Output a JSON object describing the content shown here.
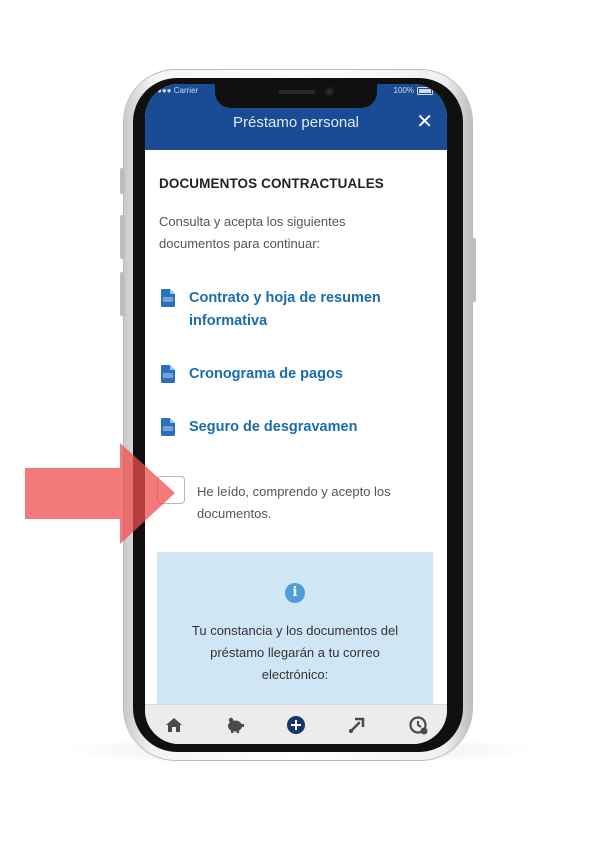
{
  "status_bar": {
    "carrier": "Carrier",
    "battery": "100%"
  },
  "header": {
    "title": "Préstamo personal",
    "close_symbol": "✕"
  },
  "section_title": "DOCUMENTOS CONTRACTUALES",
  "intro_lines": [
    "Consulta y acepta los siguientes",
    "documentos  para continuar:"
  ],
  "documents": [
    {
      "label_lines": [
        "Contrato y hoja de resumen",
        "informativa"
      ],
      "icon": "pdf-file-icon"
    },
    {
      "label_lines": [
        "Cronograma de pagos"
      ],
      "icon": "pdf-file-icon"
    },
    {
      "label_lines": [
        "Seguro de desgravamen"
      ],
      "icon": "pdf-file-icon"
    }
  ],
  "acceptance": {
    "checked": false,
    "label_lines": [
      "He leído, comprendo y acepto los",
      "documentos."
    ]
  },
  "info_box": {
    "icon": "info-icon",
    "icon_symbol": "i",
    "text_lines": [
      "Tu constancia y los documentos del",
      "préstamo llegarán a tu correo",
      "electrónico:"
    ]
  },
  "bottom_nav": [
    {
      "icon": "home-icon"
    },
    {
      "icon": "piggy-bank-icon"
    },
    {
      "icon": "plus-icon"
    },
    {
      "icon": "transfer-icon"
    },
    {
      "icon": "clock-icon"
    }
  ],
  "colors": {
    "header": "#1a4c96",
    "link": "#1a6cae",
    "info_bg": "#cfe7f4",
    "arrow": "#f04e4e"
  }
}
